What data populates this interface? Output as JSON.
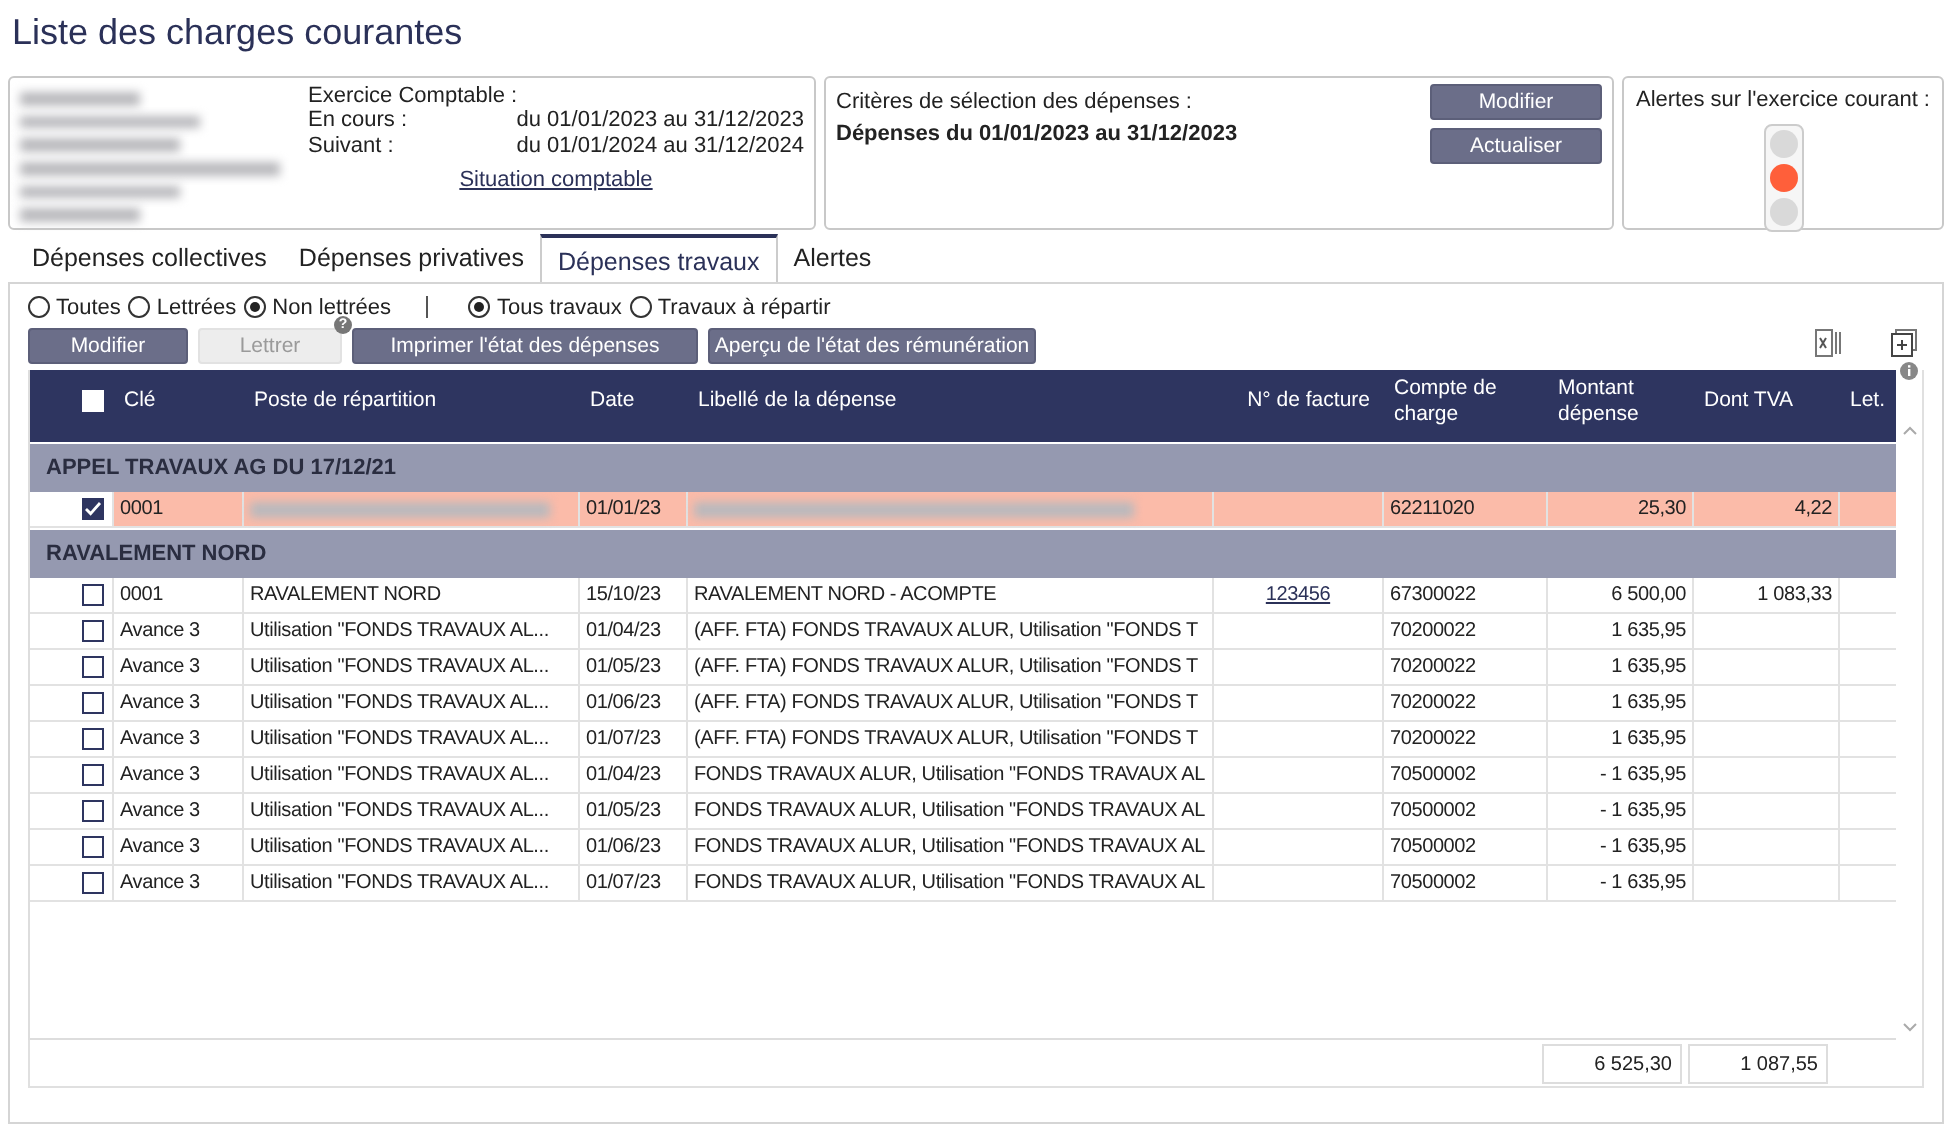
{
  "title": "Liste des charges courantes",
  "info": {
    "address_redacted": true,
    "exercice_label": "Exercice Comptable :",
    "periods": [
      {
        "label": "En cours :",
        "value": "du 01/01/2023 au 31/12/2023"
      },
      {
        "label": "Suivant :",
        "value": "du 01/01/2024 au 31/12/2024"
      }
    ],
    "link": "Situation comptable"
  },
  "criteria": {
    "label": "Critères de sélection des dépenses :",
    "value": "Dépenses du 01/01/2023  au 31/12/2023",
    "buttons": [
      "Modifier",
      "Actualiser"
    ]
  },
  "alerts": {
    "label": "Alertes sur l'exercice courant :",
    "lights": [
      {
        "on": false
      },
      {
        "on": true
      },
      {
        "on": false
      }
    ]
  },
  "tabs": [
    {
      "label": "Dépenses collectives",
      "selected": false
    },
    {
      "label": "Dépenses privatives",
      "selected": false
    },
    {
      "label": "Dépenses travaux",
      "selected": true
    },
    {
      "label": "Alertes",
      "selected": false
    }
  ],
  "filters": [
    [
      {
        "label": "Toutes",
        "selected": false
      },
      {
        "label": "Lettrées",
        "selected": false
      },
      {
        "label": "Non lettrées",
        "selected": true
      }
    ],
    [
      {
        "label": "Tous travaux",
        "selected": true
      },
      {
        "label": "Travaux à répartir",
        "selected": false
      }
    ]
  ],
  "actions": [
    {
      "label": "Modifier",
      "disabled": false
    },
    {
      "label": "Lettrer",
      "disabled": true,
      "help": "?"
    },
    {
      "label": "Imprimer l'état des dépenses",
      "disabled": false
    },
    {
      "label": "Aperçu de l'état des rémunération",
      "disabled": false
    }
  ],
  "table": {
    "header_checked": false,
    "columns": [
      {
        "label": "Clé",
        "kind": "text"
      },
      {
        "label": "Poste de répartition",
        "kind": "text"
      },
      {
        "label": "Date",
        "kind": "text"
      },
      {
        "label": "Libellé de la dépense",
        "kind": "text"
      },
      {
        "label": "N° de facture",
        "kind": "link"
      },
      {
        "label": "Compte de charge",
        "kind": "text"
      },
      {
        "label": "Montant dépense",
        "kind": "amount"
      },
      {
        "label": "Dont TVA",
        "kind": "amount"
      },
      {
        "label": "Let.",
        "kind": "text"
      }
    ],
    "groups": [
      {
        "title": "APPEL TRAVAUX AG DU 17/12/21",
        "rows": [
          {
            "checked": true,
            "selected": true,
            "cells": [
              "0001",
              null,
              "01/01/23",
              null,
              "",
              "62211020",
              "25,30",
              "4,22",
              ""
            ]
          }
        ]
      },
      {
        "title": "RAVALEMENT NORD",
        "rows": [
          {
            "checked": false,
            "selected": false,
            "cells": [
              "0001",
              "RAVALEMENT NORD",
              "15/10/23",
              "RAVALEMENT NORD - ACOMPTE",
              "123456",
              "67300022",
              "6 500,00",
              "1 083,33",
              ""
            ]
          },
          {
            "checked": false,
            "selected": false,
            "cells": [
              "Avance 3",
              "Utilisation \"FONDS TRAVAUX AL...",
              "01/04/23",
              "(AFF. FTA) FONDS TRAVAUX ALUR, Utilisation \"FONDS T",
              "",
              "70200022",
              "1 635,95",
              "",
              ""
            ]
          },
          {
            "checked": false,
            "selected": false,
            "cells": [
              "Avance 3",
              "Utilisation \"FONDS TRAVAUX AL...",
              "01/05/23",
              "(AFF. FTA) FONDS TRAVAUX ALUR, Utilisation \"FONDS T",
              "",
              "70200022",
              "1 635,95",
              "",
              ""
            ]
          },
          {
            "checked": false,
            "selected": false,
            "cells": [
              "Avance 3",
              "Utilisation \"FONDS TRAVAUX AL...",
              "01/06/23",
              "(AFF. FTA) FONDS TRAVAUX ALUR, Utilisation \"FONDS T",
              "",
              "70200022",
              "1 635,95",
              "",
              ""
            ]
          },
          {
            "checked": false,
            "selected": false,
            "cells": [
              "Avance 3",
              "Utilisation \"FONDS TRAVAUX AL...",
              "01/07/23",
              "(AFF. FTA) FONDS TRAVAUX ALUR, Utilisation \"FONDS T",
              "",
              "70200022",
              "1 635,95",
              "",
              ""
            ]
          },
          {
            "checked": false,
            "selected": false,
            "cells": [
              "Avance 3",
              "Utilisation \"FONDS TRAVAUX AL...",
              "01/04/23",
              "FONDS TRAVAUX ALUR, Utilisation \"FONDS TRAVAUX AL",
              "",
              "70500002",
              "- 1 635,95",
              "",
              ""
            ]
          },
          {
            "checked": false,
            "selected": false,
            "cells": [
              "Avance 3",
              "Utilisation \"FONDS TRAVAUX AL...",
              "01/05/23",
              "FONDS TRAVAUX ALUR, Utilisation \"FONDS TRAVAUX AL",
              "",
              "70500002",
              "- 1 635,95",
              "",
              ""
            ]
          },
          {
            "checked": false,
            "selected": false,
            "cells": [
              "Avance 3",
              "Utilisation \"FONDS TRAVAUX AL...",
              "01/06/23",
              "FONDS TRAVAUX ALUR, Utilisation \"FONDS TRAVAUX AL",
              "",
              "70500002",
              "- 1 635,95",
              "",
              ""
            ]
          },
          {
            "checked": false,
            "selected": false,
            "cells": [
              "Avance 3",
              "Utilisation \"FONDS TRAVAUX AL...",
              "01/07/23",
              "FONDS TRAVAUX ALUR, Utilisation \"FONDS TRAVAUX AL",
              "",
              "70500002",
              "- 1 635,95",
              "",
              ""
            ]
          }
        ]
      }
    ],
    "totals": [
      "6 525,30",
      "1 087,55"
    ]
  }
}
